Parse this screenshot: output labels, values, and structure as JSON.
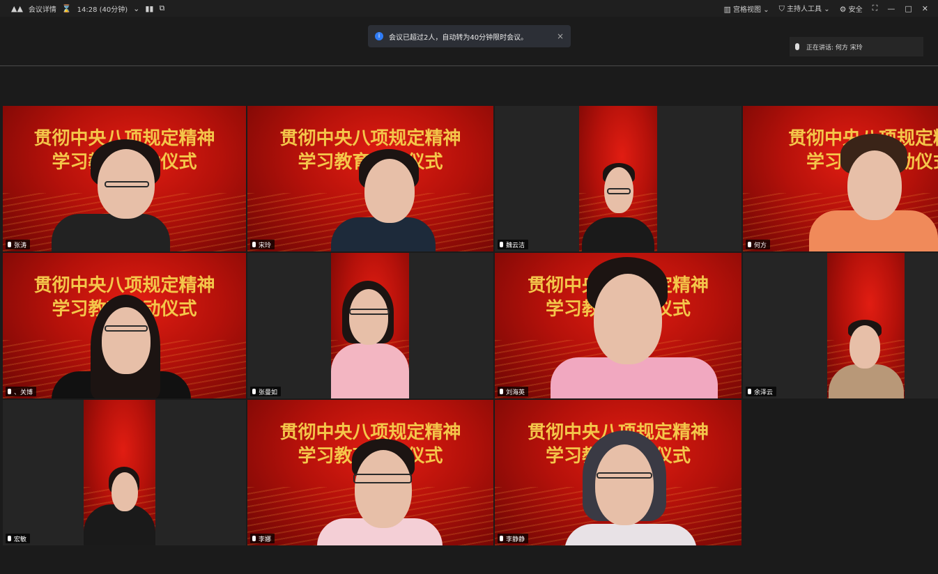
{
  "topbar": {
    "app_name": "会议详情",
    "timer": "14:28 (40分钟)",
    "view_label": "宫格视图",
    "host_tools": "主持人工具",
    "security": "安全"
  },
  "toast": {
    "info_icon": "i",
    "text": "会议已超过2人，自动转为40分钟限时会议。",
    "close": "×"
  },
  "speaking": {
    "text": "正在讲话: 何方 宋玲"
  },
  "slide": {
    "line1": "贯彻中央八项规定精神",
    "line2": "学习教育启动仪式"
  },
  "participants": [
    {
      "name": "张涛"
    },
    {
      "name": "宋玲"
    },
    {
      "name": "魏云洁"
    },
    {
      "name": "何方"
    },
    {
      "name": "、关博"
    },
    {
      "name": "张曼如"
    },
    {
      "name": "刘海英"
    },
    {
      "name": "余泽云"
    },
    {
      "name": "宏敏"
    },
    {
      "name": "李娜"
    },
    {
      "name": "李静静"
    }
  ]
}
